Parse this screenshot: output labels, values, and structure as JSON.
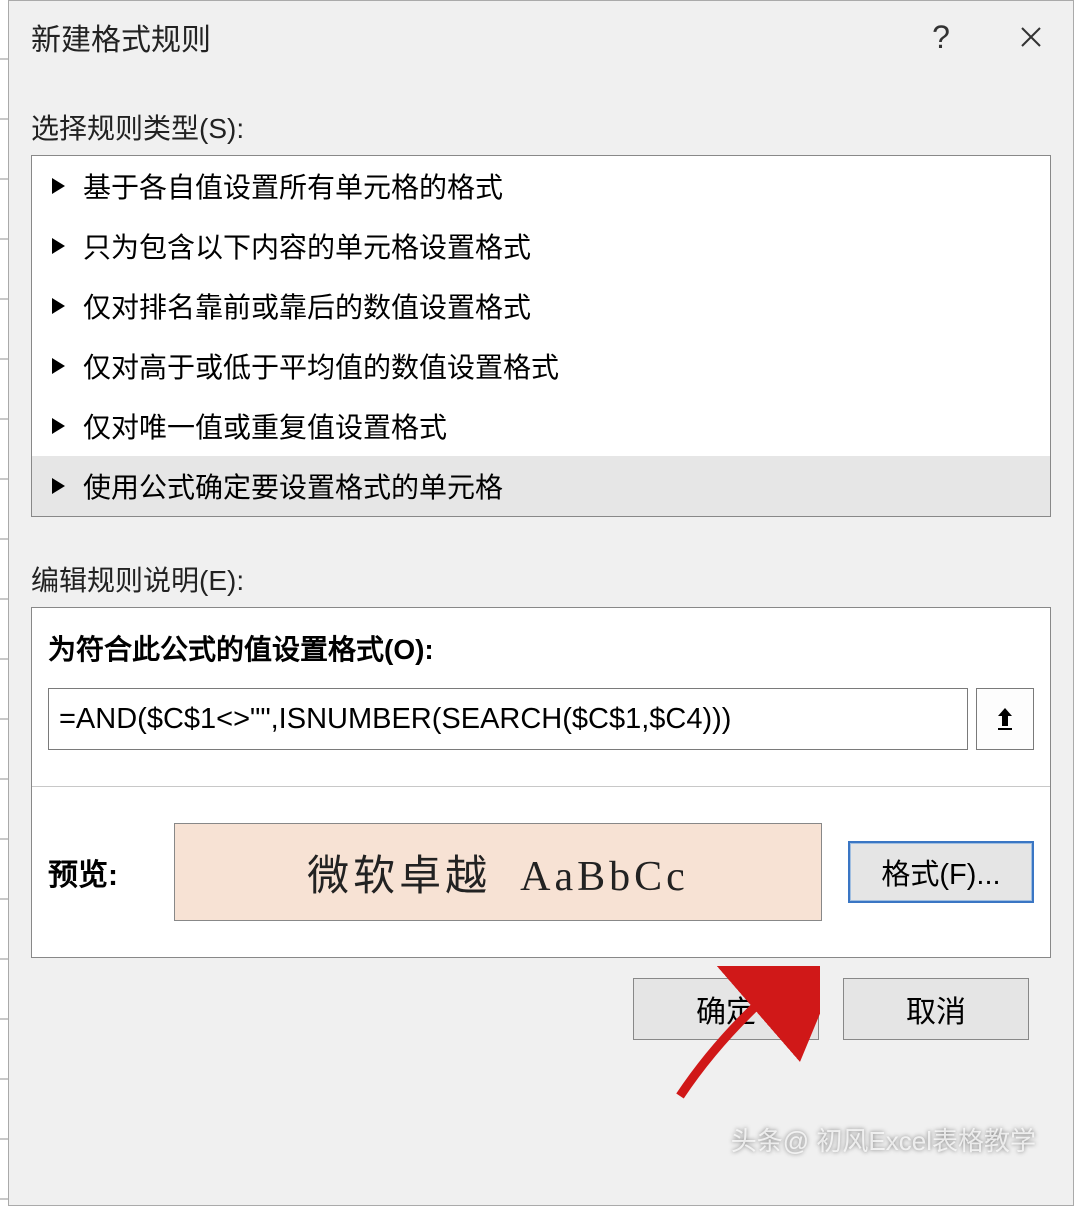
{
  "dialog": {
    "title": "新建格式规则",
    "rule_type_label": "选择规则类型(S):",
    "rule_types": [
      "基于各自值设置所有单元格的格式",
      "只为包含以下内容的单元格设置格式",
      "仅对排名靠前或靠后的数值设置格式",
      "仅对高于或低于平均值的数值设置格式",
      "仅对唯一值或重复值设置格式",
      "使用公式确定要设置格式的单元格"
    ],
    "selected_rule_index": 5,
    "edit_label": "编辑规则说明(E):",
    "formula_label": "为符合此公式的值设置格式(O):",
    "formula_value": "=AND($C$1<>\"\",ISNUMBER(SEARCH($C$1,$C4)))",
    "preview_label": "预览:",
    "preview_text": "微软卓越  AaBbCc",
    "format_button": "格式(F)...",
    "ok_button": "确定",
    "cancel_button": "取消"
  },
  "watermark": "头条@  初风Excel表格教学"
}
